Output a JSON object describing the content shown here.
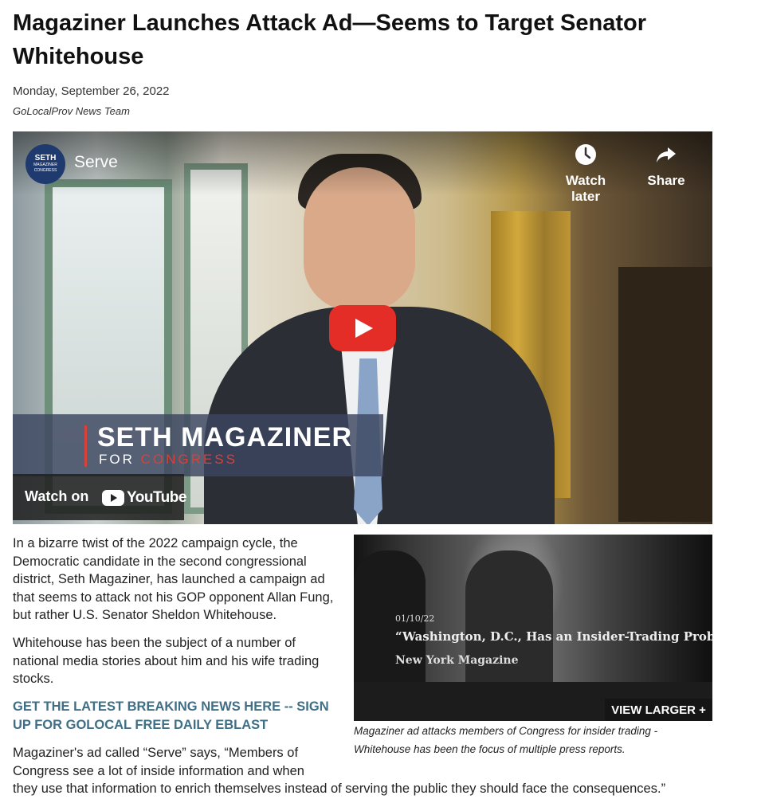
{
  "article": {
    "headline": "Magaziner Launches Attack Ad—Seems to Target Senator Whitehouse",
    "date": "Monday, September 26, 2022",
    "byline": "GoLocalProv News Team"
  },
  "video": {
    "channel_logo_line1": "SETH",
    "channel_logo_line2": "MAGAZINER",
    "channel_logo_line3": "CONGRESS",
    "title": "Serve",
    "watch_later_label": "Watch later",
    "share_label": "Share",
    "lower_third_name": "SETH MAGAZINER",
    "lower_third_for": "FOR ",
    "lower_third_congress": "CONGRESS",
    "watch_on_label": "Watch on",
    "youtube_wordmark": "YouTube"
  },
  "body": {
    "paragraph1": "In a bizarre twist of the 2022 campaign cycle, the Democratic candidate in the second congressional district, Seth Magaziner, has launched a campaign ad that seems to attack not his GOP opponent Allan Fung, but rather U.S. Senator Sheldon Whitehouse.",
    "paragraph2": "Whitehouse has been the subject of a number of national media stories about him and his wife trading stocks.",
    "cta_link": "GET THE LATEST BREAKING NEWS HERE -- SIGN UP FOR GOLOCAL FREE DAILY EBLAST",
    "paragraph3_line1": "Magaziner's ad called “Serve” says, “Members of Congress see a lot of inside information and when",
    "paragraph3_rest": "they use that information to enrich themselves instead of serving the public they should face the consequences.”"
  },
  "photo": {
    "date_tag": "01/10/22",
    "quote": "“Washington, D.C., Has an Insider-Trading Problem”",
    "source": "New York Magazine",
    "view_larger_label": "VIEW LARGER +",
    "caption": "Magaziner ad attacks members of Congress for insider trading - Whitehouse has been the focus of multiple press reports."
  },
  "colors": {
    "cta": "#3f6f86",
    "play_button": "#e52d27",
    "accent_red": "#d8403a"
  },
  "icons": [
    "clock-icon",
    "share-arrow-icon",
    "play-icon",
    "youtube-icon"
  ]
}
